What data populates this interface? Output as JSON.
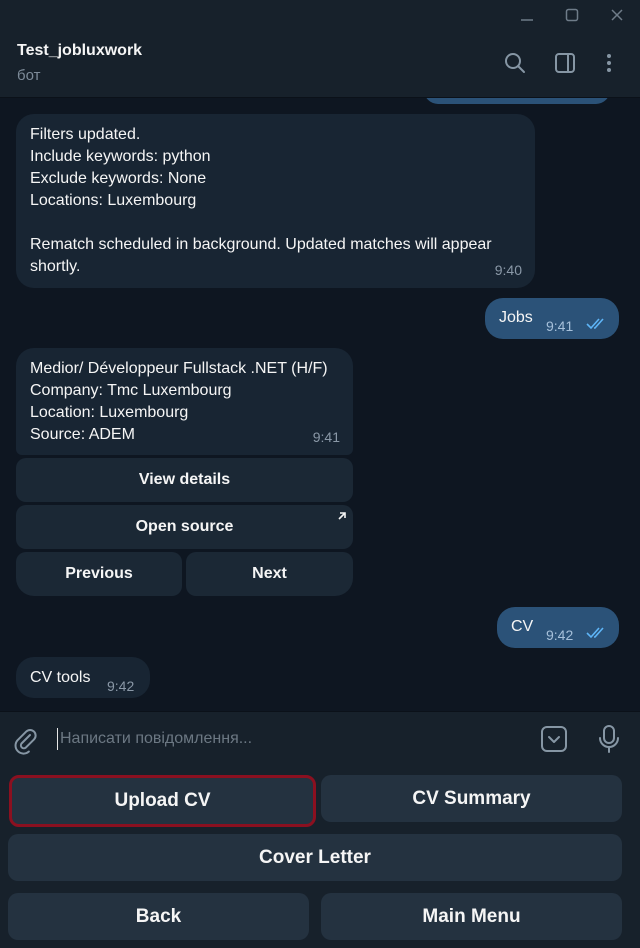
{
  "header": {
    "title": "Test_jobluxwork",
    "subtitle": "бот"
  },
  "messages": [
    {
      "direction": "incoming",
      "lines": [
        "Filters updated.",
        "Include keywords: python",
        "Exclude keywords: None",
        "Locations: Luxembourg",
        "",
        "Rematch scheduled in background. Updated matches will appear",
        "shortly."
      ],
      "time": "9:40"
    },
    {
      "direction": "outgoing",
      "text": "Jobs",
      "time": "9:41",
      "status": "read"
    },
    {
      "direction": "incoming",
      "lines": [
        "Medior/ Développeur Fullstack .NET (H/F)",
        "Company: Tmc Luxembourg",
        "Location: Luxembourg",
        "Source: ADEM"
      ],
      "time": "9:41",
      "buttons": {
        "view_details": "View details",
        "open_source": "Open source",
        "previous": "Previous",
        "next": "Next"
      }
    },
    {
      "direction": "outgoing",
      "text": "CV",
      "time": "9:42",
      "status": "read"
    },
    {
      "direction": "incoming",
      "text": "CV tools",
      "time": "9:42"
    }
  ],
  "input": {
    "placeholder": "Написати повідомлення..."
  },
  "reply_keyboard": {
    "upload_cv": "Upload CV",
    "cv_summary": "CV Summary",
    "cover_letter": "Cover Letter",
    "back": "Back",
    "main_menu": "Main Menu",
    "selected": "upload_cv"
  },
  "colors": {
    "background": "#0e1621",
    "panel": "#17212b",
    "incoming_bubble": "#182533",
    "outgoing_bubble": "#2b5278",
    "selection_border": "#8b1020",
    "accent": "#5eb5f7"
  },
  "icons": [
    "minimize-icon",
    "maximize-icon",
    "close-icon",
    "search-icon",
    "sidebar-toggle-icon",
    "more-vertical-icon",
    "paperclip-icon",
    "sticker-icon",
    "microphone-icon",
    "external-link-icon",
    "double-check-icon"
  ]
}
